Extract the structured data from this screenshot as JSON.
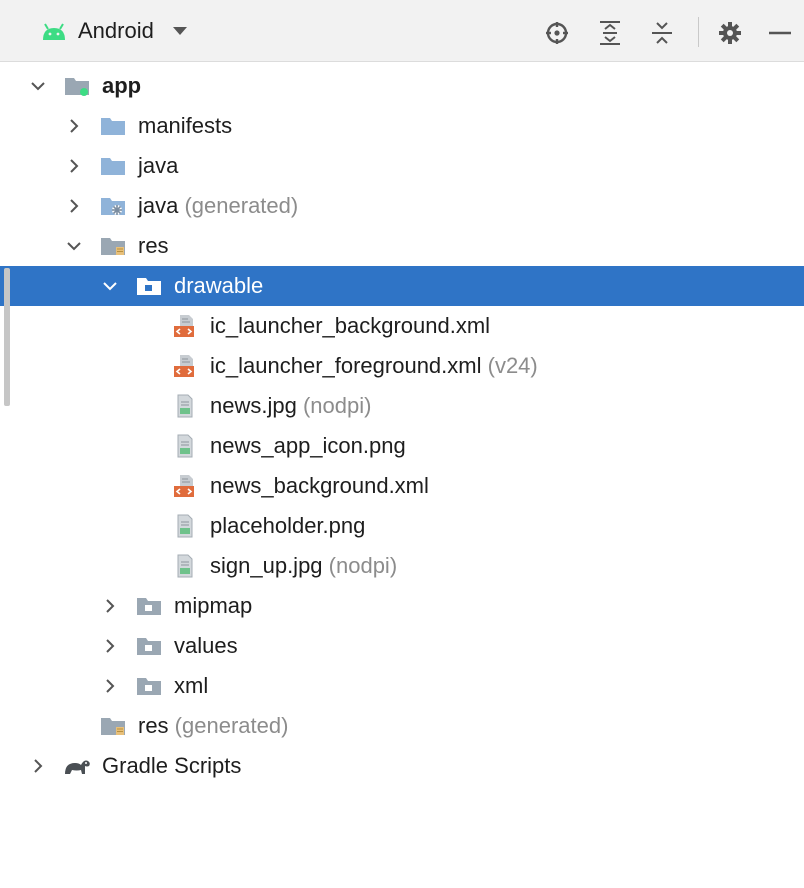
{
  "toolbar": {
    "view_label": "Android",
    "icons": [
      "select-opened-file-icon",
      "expand-all-icon",
      "collapse-all-icon",
      "gear-icon",
      "hide-icon"
    ]
  },
  "colors": {
    "selection": "#2f74c6",
    "folder": "#8fb3d9",
    "res_folder": "#9aa7b3",
    "xml_badge": "#e06c3c",
    "hint_text": "#8c8c8c",
    "android_green": "#3ddc84"
  },
  "tree": [
    {
      "label": "app",
      "hint": "",
      "depth": 0,
      "expanded": true,
      "icon": "module-folder-icon"
    },
    {
      "label": "manifests",
      "hint": "",
      "depth": 1,
      "expanded": false,
      "icon": "folder-icon"
    },
    {
      "label": "java",
      "hint": "",
      "depth": 1,
      "expanded": false,
      "icon": "folder-icon"
    },
    {
      "label": "java",
      "hint": "(generated)",
      "depth": 1,
      "expanded": false,
      "icon": "generated-folder-icon"
    },
    {
      "label": "res",
      "hint": "",
      "depth": 1,
      "expanded": true,
      "icon": "resources-folder-icon"
    },
    {
      "label": "drawable",
      "hint": "",
      "depth": 2,
      "expanded": true,
      "icon": "package-folder-icon",
      "selected": true
    },
    {
      "label": "ic_launcher_background.xml",
      "hint": "",
      "depth": 3,
      "icon": "xml-file-icon"
    },
    {
      "label": "ic_launcher_foreground.xml",
      "hint": "(v24)",
      "depth": 3,
      "icon": "xml-file-icon"
    },
    {
      "label": "news.jpg",
      "hint": "(nodpi)",
      "depth": 3,
      "icon": "image-file-icon"
    },
    {
      "label": "news_app_icon.png",
      "hint": "",
      "depth": 3,
      "icon": "image-file-icon"
    },
    {
      "label": "news_background.xml",
      "hint": "",
      "depth": 3,
      "icon": "xml-file-icon"
    },
    {
      "label": "placeholder.png",
      "hint": "",
      "depth": 3,
      "icon": "image-file-icon"
    },
    {
      "label": "sign_up.jpg",
      "hint": "(nodpi)",
      "depth": 3,
      "icon": "image-file-icon"
    },
    {
      "label": "mipmap",
      "hint": "",
      "depth": 2,
      "expanded": false,
      "icon": "package-folder-icon"
    },
    {
      "label": "values",
      "hint": "",
      "depth": 2,
      "expanded": false,
      "icon": "package-folder-icon"
    },
    {
      "label": "xml",
      "hint": "",
      "depth": 2,
      "expanded": false,
      "icon": "package-folder-icon"
    },
    {
      "label": "res",
      "hint": "(generated)",
      "depth": 1,
      "icon": "generated-resources-folder-icon"
    },
    {
      "label": "Gradle Scripts",
      "hint": "",
      "depth": 0,
      "expanded": false,
      "icon": "gradle-icon"
    }
  ]
}
